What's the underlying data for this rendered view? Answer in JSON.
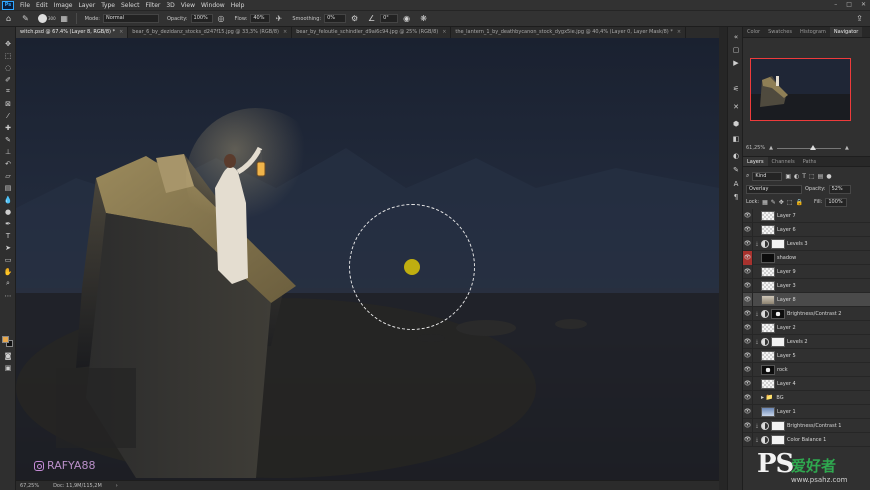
{
  "menubar": {
    "logo": "Ps",
    "items": [
      "File",
      "Edit",
      "Image",
      "Layer",
      "Type",
      "Select",
      "Filter",
      "3D",
      "View",
      "Window",
      "Help"
    ]
  },
  "options": {
    "brush_size": "300",
    "mode_label": "Mode:",
    "mode_value": "Normal",
    "opacity_label": "Opacity:",
    "opacity_value": "100%",
    "flow_label": "Flow:",
    "flow_value": "40%",
    "smoothing_label": "Smoothing:",
    "smoothing_value": "0%",
    "angle_value": "0°"
  },
  "tabs": [
    {
      "label": "witch.psd @ 67.4% (Layer 8, RGB/8) *"
    },
    {
      "label": "bear_6_by_dezidanz_stocks_d247f15.jpg @ 33,3% (RGB/8)"
    },
    {
      "label": "bear_by_feloutle_schindler_d9ai6c94.jpg @ 25% (RGB/8)"
    },
    {
      "label": "the_lantern_1_by_deathbycanon_stock_dygx5ie.jpg @ 40,4% (Layer 0, Layer Mask/8) *"
    }
  ],
  "canvas": {
    "watermark": "RAFYA88"
  },
  "status": {
    "zoom": "67,25%",
    "doc": "Doc: 11,9M/115,2M"
  },
  "navigator": {
    "tabs": [
      "Color",
      "Swatches",
      "Histogram",
      "Navigator"
    ],
    "zoom": "61,25%"
  },
  "layers_panel": {
    "tabs": [
      "Layers",
      "Channels",
      "Paths"
    ],
    "filter_kind": "Kind",
    "blend_mode": "Overlay",
    "opacity_label": "Opacity:",
    "opacity_value": "52%",
    "lock_label": "Lock:",
    "fill_label": "Fill:",
    "fill_value": "100%",
    "layers": [
      {
        "name": "Layer 7",
        "thumb": "checker",
        "adj": false,
        "eye_red": false,
        "selected": false
      },
      {
        "name": "Layer 6",
        "thumb": "checker",
        "adj": false,
        "eye_red": false,
        "selected": false
      },
      {
        "name": "Levels 3",
        "thumb": "white",
        "adj": true,
        "eye_red": false,
        "selected": false
      },
      {
        "name": "shadow",
        "thumb": "black",
        "adj": false,
        "eye_red": true,
        "selected": false
      },
      {
        "name": "Layer 9",
        "thumb": "checker",
        "adj": false,
        "eye_red": false,
        "selected": false
      },
      {
        "name": "Layer 3",
        "thumb": "checker",
        "adj": false,
        "eye_red": false,
        "selected": false
      },
      {
        "name": "Layer 8",
        "thumb": "img",
        "adj": false,
        "eye_red": false,
        "selected": true
      },
      {
        "name": "Brightness/Contrast 2",
        "thumb": "blackdot",
        "adj": true,
        "eye_red": false,
        "selected": false
      },
      {
        "name": "Layer 2",
        "thumb": "checker",
        "adj": false,
        "eye_red": false,
        "selected": false
      },
      {
        "name": "Levels 2",
        "thumb": "white",
        "adj": true,
        "eye_red": false,
        "selected": false
      },
      {
        "name": "Layer 5",
        "thumb": "checker",
        "adj": false,
        "eye_red": false,
        "selected": false
      },
      {
        "name": "rock",
        "thumb": "blackdot",
        "adj": false,
        "eye_red": false,
        "selected": false
      },
      {
        "name": "Layer 4",
        "thumb": "checker",
        "adj": false,
        "eye_red": false,
        "selected": false
      },
      {
        "name": "BG",
        "thumb": "folder",
        "adj": false,
        "eye_red": false,
        "selected": false
      },
      {
        "name": "Layer 1",
        "thumb": "sky",
        "adj": false,
        "eye_red": false,
        "selected": false
      },
      {
        "name": "Brightness/Contrast 1",
        "thumb": "white",
        "adj": true,
        "eye_red": false,
        "selected": false
      },
      {
        "name": "Color Balance 1",
        "thumb": "white",
        "adj": true,
        "eye_red": false,
        "selected": false
      }
    ]
  },
  "brand": {
    "logo_letters": "PS",
    "chinese": "爱好者",
    "url": "www.psahz.com"
  }
}
